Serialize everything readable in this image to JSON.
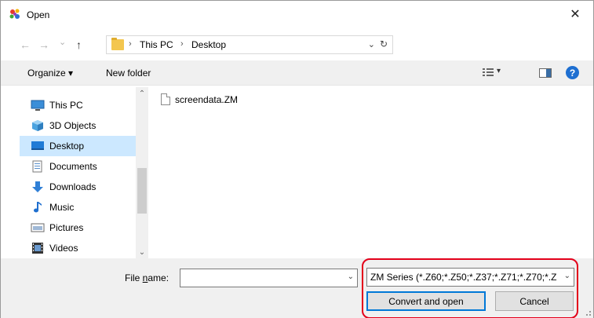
{
  "window": {
    "title": "Open",
    "close_glyph": "✕"
  },
  "nav": {
    "back_glyph": "←",
    "forward_glyph": "→",
    "recent_glyph": "⌄",
    "up_glyph": "↑",
    "breadcrumbs": [
      "This PC",
      "Desktop"
    ],
    "sep_glyph": "›",
    "addr_drop_glyph": "⌄",
    "refresh_glyph": "↻"
  },
  "toolbar": {
    "organize_label": "Organize ▾",
    "new_folder_label": "New folder",
    "view_drop_glyph": "▾",
    "help_glyph": "?"
  },
  "navpane": {
    "items": [
      {
        "label": "This PC",
        "icon": "pc-icon"
      },
      {
        "label": "3D Objects",
        "icon": "cube-icon"
      },
      {
        "label": "Desktop",
        "icon": "desktop-icon",
        "selected": true
      },
      {
        "label": "Documents",
        "icon": "document-icon"
      },
      {
        "label": "Downloads",
        "icon": "download-icon"
      },
      {
        "label": "Music",
        "icon": "music-icon"
      },
      {
        "label": "Pictures",
        "icon": "pictures-icon"
      },
      {
        "label": "Videos",
        "icon": "video-icon"
      }
    ],
    "scroll_up_glyph": "⌃",
    "scroll_down_glyph": "⌄"
  },
  "files": [
    {
      "name": "screendata.ZM",
      "icon": "file-icon"
    }
  ],
  "bottom": {
    "file_name_label_pre": "File ",
    "file_name_label_ul": "n",
    "file_name_label_post": "ame:",
    "file_name_value": "",
    "file_name_drop_glyph": "⌄",
    "filter_value": "ZM Series (*.Z60;*.Z50;*.Z37;*.Z71;*.Z70;*.Z",
    "filter_drop_glyph": "⌄",
    "convert_label": "Convert and open",
    "cancel_label": "Cancel"
  },
  "colors": {
    "highlight": "#e3001b",
    "selection": "#cce8ff",
    "accent": "#0078d7"
  }
}
